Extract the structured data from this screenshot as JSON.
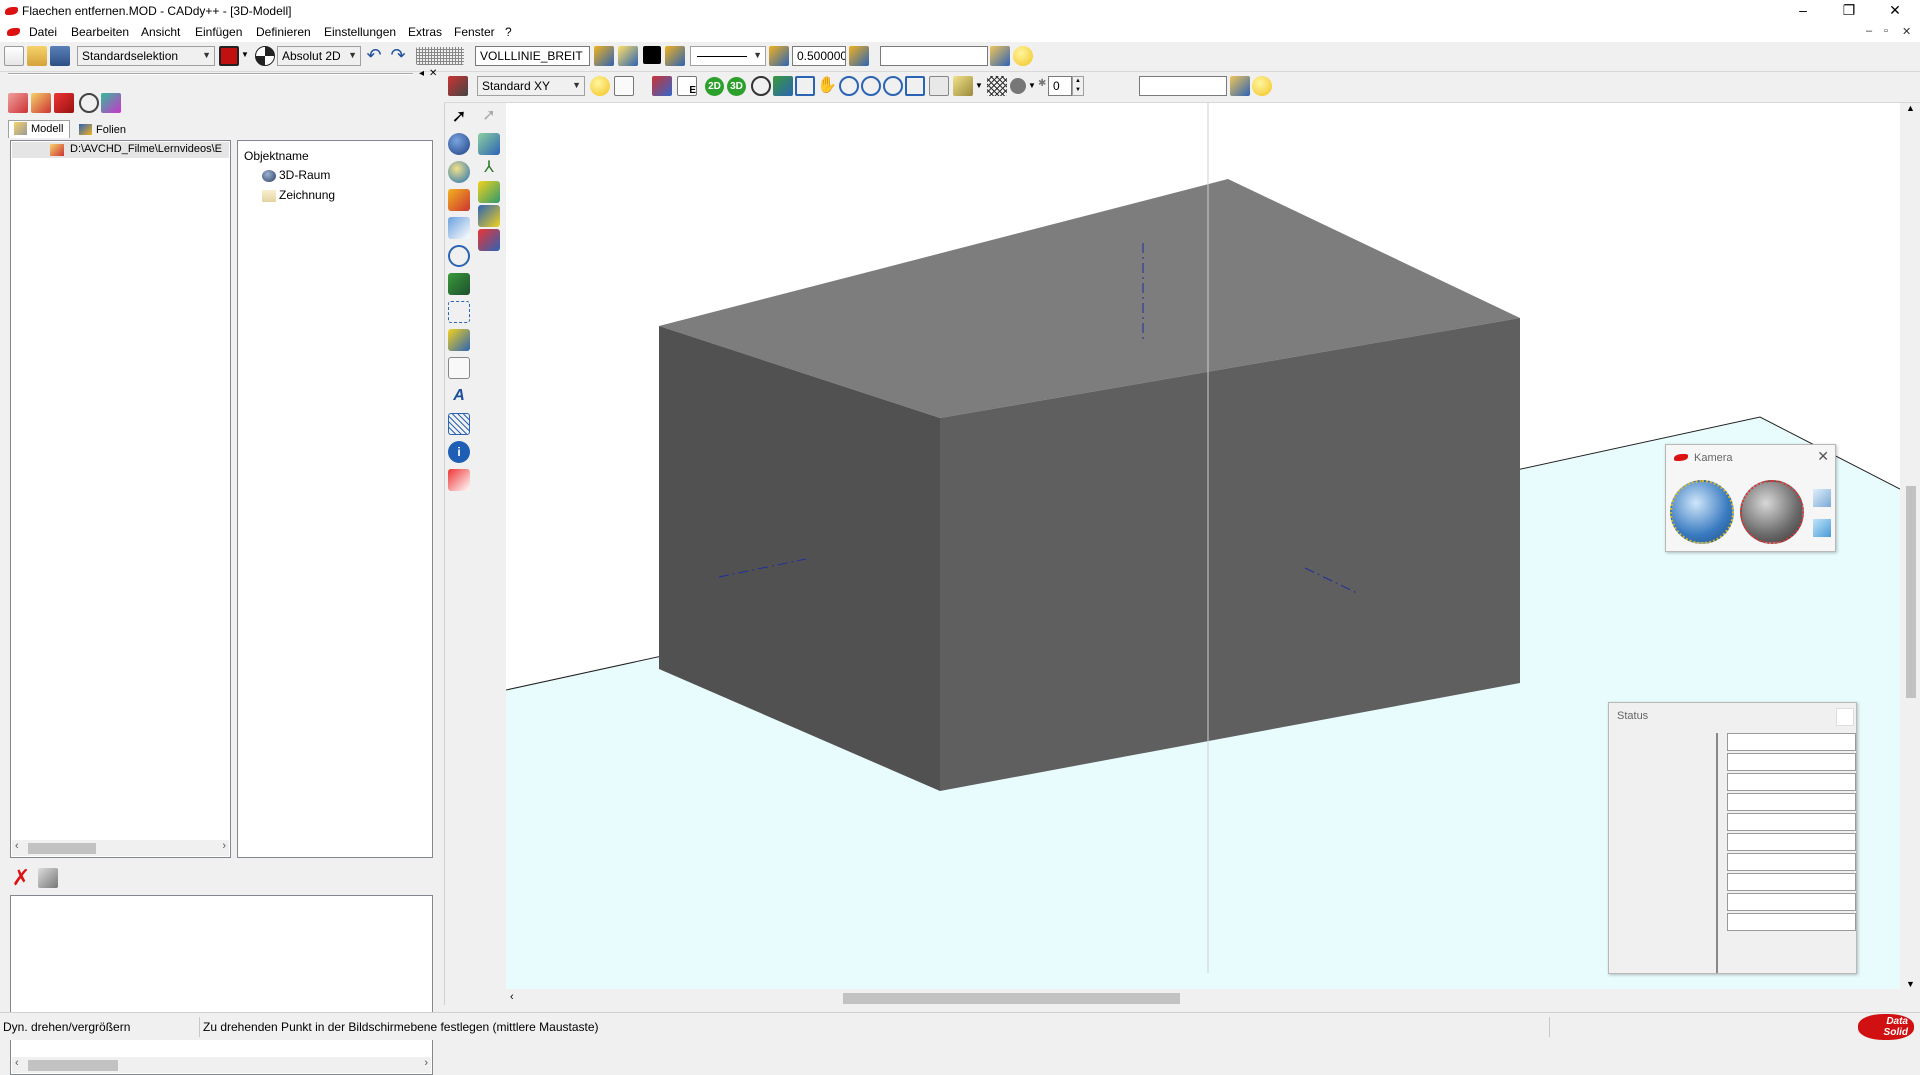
{
  "window": {
    "title": "Flaechen entfernen.MOD  -  CADdy++  -  [3D-Modell]",
    "controls": [
      "–",
      "❐",
      "✕"
    ],
    "mdi_controls": [
      "–",
      "▫",
      "✕"
    ]
  },
  "menu": [
    "Datei",
    "Bearbeiten",
    "Ansicht",
    "Einfügen",
    "Definieren",
    "Einstellungen",
    "Extras",
    "Fenster",
    "?"
  ],
  "toolbar1": {
    "selection_mode": "Standardselektion",
    "coord_mode": "Absolut 2D",
    "layer_name": "VOLLLINIE_BREIT",
    "line_width": "0.500000",
    "layer_field": ""
  },
  "toolbar2": {
    "view_plane": "Standard XY",
    "btn_2d": "2D",
    "btn_3d": "3D",
    "spin_value": "0",
    "text_field": ""
  },
  "left_panel": {
    "close_symbols": [
      "◂",
      "✕"
    ],
    "tabs": [
      "Modell",
      "Folien"
    ],
    "tree_path": "D:\\AVCHD_Filme\\Lernvideos\\E",
    "object_header": "Objektname",
    "objects": [
      "3D-Raum",
      "Zeichnung"
    ]
  },
  "kamera": {
    "title": "Kamera"
  },
  "status_window": {
    "title": "Status",
    "rows": 10
  },
  "statusbar": {
    "mode": "Dyn. drehen/vergrößern",
    "hint": "Zu drehenden Punkt in der Bildschirmebene festlegen (mittlere Maustaste)",
    "logo_line1": "Data",
    "logo_line2": "Solid"
  },
  "colors": {
    "cube_front": "#515151",
    "cube_top": "#7d7d7d",
    "cube_side": "#5f5f5f",
    "ground": "#e8fcfd",
    "axis": "#1f2fa0",
    "brand_red": "#d11111"
  }
}
